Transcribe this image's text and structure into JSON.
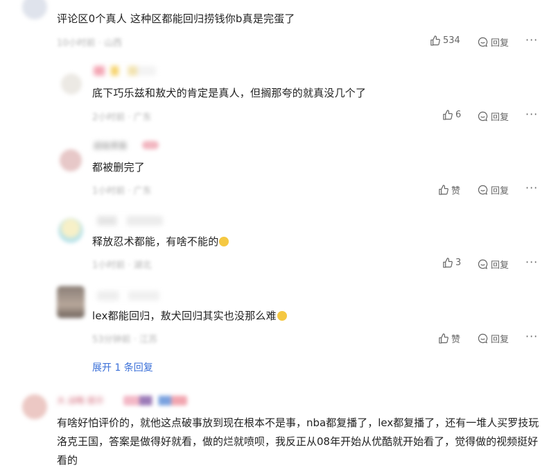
{
  "comments": [
    {
      "text": "评论区0个真人 这种区都能回归捞钱你b真是完蛋了",
      "meta": "10小时前 · 山西",
      "likes": "534",
      "reply_label": "回复",
      "more": "···"
    },
    {
      "text": "底下巧乐兹和敖犬的肯定是真人，但搁那夸的就真没几个了",
      "meta": "2小时前 · 广东",
      "likes": "6",
      "reply_label": "回复",
      "more": "···"
    },
    {
      "username": "超级黑猫",
      "text": "都被删完了",
      "meta": "1小时前 · 广东",
      "likes": "赞",
      "reply_label": "回复",
      "more": "···"
    },
    {
      "text": "释放忍术都能，有啥不能的",
      "meta": "1小时前 · 湖北",
      "likes": "3",
      "reply_label": "回复",
      "more": "···"
    },
    {
      "text": "lex都能回归，敖犬回归其实也没那么难",
      "meta": "53分钟前 · 江苏",
      "likes": "赞",
      "reply_label": "回复",
      "more": "···"
    }
  ],
  "expand_replies": "展开 1 条回复",
  "last_comment": {
    "username": "大 战略 提示",
    "text": "有啥好怕评价的，就他这点破事放到现在根本不是事，nba都复播了，lex都复播了，还有一堆人买罗技玩洛克王国，答案是做得好就看，做的烂就喷呗，我反正从08年开始从优酷就开始看了，觉得做的视频挺好看的"
  },
  "icons": [
    "thumb-up-icon",
    "reply-bubble-icon",
    "more-icon"
  ],
  "colors": {
    "text": "#222222",
    "meta": "#b3b3b3",
    "action": "#666666",
    "link": "#3a6fd8"
  }
}
